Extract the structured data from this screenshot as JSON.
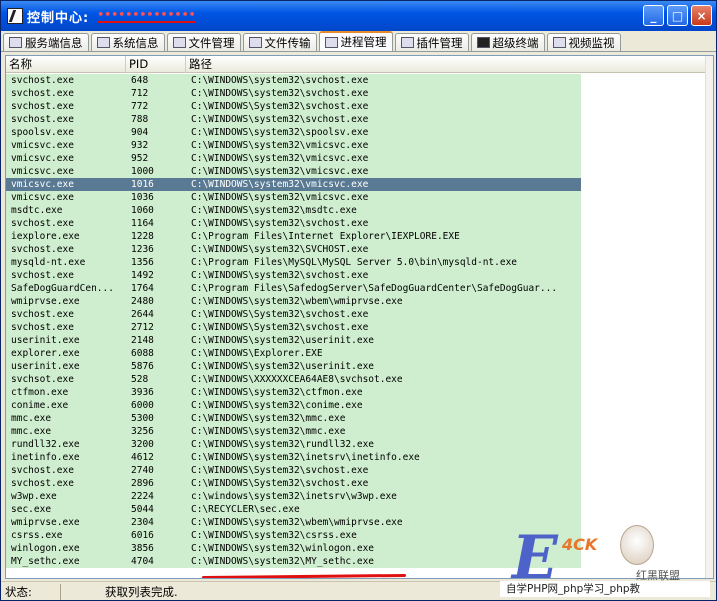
{
  "window": {
    "title": "控制中心:",
    "title_redacted": "••••••••••••••"
  },
  "titlebar_buttons": {
    "minimize": "_",
    "maximize": "□",
    "close": "×"
  },
  "tabs": [
    {
      "label": "服务端信息",
      "icon": "server-icon"
    },
    {
      "label": "系统信息",
      "icon": "system-icon"
    },
    {
      "label": "文件管理",
      "icon": "folder-icon"
    },
    {
      "label": "文件传输",
      "icon": "transfer-icon"
    },
    {
      "label": "进程管理",
      "icon": "process-icon",
      "active": true
    },
    {
      "label": "插件管理",
      "icon": "plugin-icon"
    },
    {
      "label": "超级终端",
      "icon": "terminal-icon"
    },
    {
      "label": "视频监视",
      "icon": "camera-icon"
    }
  ],
  "table": {
    "columns": [
      "名称",
      "PID",
      "路径"
    ],
    "rows": [
      [
        "svchost.exe",
        "648",
        "C:\\WINDOWS\\system32\\svchost.exe"
      ],
      [
        "svchost.exe",
        "712",
        "C:\\WINDOWS\\system32\\svchost.exe"
      ],
      [
        "svchost.exe",
        "772",
        "C:\\WINDOWS\\System32\\svchost.exe"
      ],
      [
        "svchost.exe",
        "788",
        "C:\\WINDOWS\\system32\\svchost.exe"
      ],
      [
        "spoolsv.exe",
        "904",
        "C:\\WINDOWS\\system32\\spoolsv.exe"
      ],
      [
        "vmicsvc.exe",
        "932",
        "C:\\WINDOWS\\system32\\vmicsvc.exe"
      ],
      [
        "vmicsvc.exe",
        "952",
        "C:\\WINDOWS\\system32\\vmicsvc.exe"
      ],
      [
        "vmicsvc.exe",
        "1000",
        "C:\\WINDOWS\\system32\\vmicsvc.exe"
      ],
      [
        "vmicsvc.exe",
        "1016",
        "C:\\WINDOWS\\system32\\vmicsvc.exe"
      ],
      [
        "vmicsvc.exe",
        "1036",
        "C:\\WINDOWS\\system32\\vmicsvc.exe"
      ],
      [
        "msdtc.exe",
        "1060",
        "C:\\WINDOWS\\system32\\msdtc.exe"
      ],
      [
        "svchost.exe",
        "1164",
        "C:\\WINDOWS\\system32\\svchost.exe"
      ],
      [
        "iexplore.exe",
        "1228",
        "C:\\Program Files\\Internet Explorer\\IEXPLORE.EXE"
      ],
      [
        "svchost.exe",
        "1236",
        "C:\\WINDOWS\\system32\\SVCHOST.exe"
      ],
      [
        "mysqld-nt.exe",
        "1356",
        "C:\\Program Files\\MySQL\\MySQL Server 5.0\\bin\\mysqld-nt.exe"
      ],
      [
        "svchost.exe",
        "1492",
        "C:\\WINDOWS\\system32\\svchost.exe"
      ],
      [
        "SafeDogGuardCen...",
        "1764",
        "C:\\Program Files\\SafedogServer\\SafeDogGuardCenter\\SafeDogGuar..."
      ],
      [
        "wmiprvse.exe",
        "2480",
        "C:\\WINDOWS\\system32\\wbem\\wmiprvse.exe"
      ],
      [
        "svchost.exe",
        "2644",
        "C:\\WINDOWS\\System32\\svchost.exe"
      ],
      [
        "svchost.exe",
        "2712",
        "C:\\WINDOWS\\System32\\svchost.exe"
      ],
      [
        "userinit.exe",
        "2148",
        "C:\\WINDOWS\\system32\\userinit.exe"
      ],
      [
        "explorer.exe",
        "6088",
        "C:\\WINDOWS\\Explorer.EXE"
      ],
      [
        "userinit.exe",
        "5876",
        "C:\\WINDOWS\\system32\\userinit.exe"
      ],
      [
        "svchsot.exe",
        "528",
        "C:\\WINDOWS\\XXXXXXCEA64AE8\\svchsot.exe"
      ],
      [
        "ctfmon.exe",
        "3936",
        "C:\\WINDOWS\\system32\\ctfmon.exe"
      ],
      [
        "conime.exe",
        "6000",
        "C:\\WINDOWS\\system32\\conime.exe"
      ],
      [
        "mmc.exe",
        "5300",
        "C:\\WINDOWS\\system32\\mmc.exe"
      ],
      [
        "mmc.exe",
        "3256",
        "C:\\WINDOWS\\system32\\mmc.exe"
      ],
      [
        "rundll32.exe",
        "3200",
        "C:\\WINDOWS\\system32\\rundll32.exe"
      ],
      [
        "inetinfo.exe",
        "4612",
        "C:\\WINDOWS\\system32\\inetsrv\\inetinfo.exe"
      ],
      [
        "svchost.exe",
        "2740",
        "C:\\WINDOWS\\System32\\svchost.exe"
      ],
      [
        "svchost.exe",
        "2896",
        "C:\\WINDOWS\\System32\\svchost.exe"
      ],
      [
        "w3wp.exe",
        "2224",
        "c:\\windows\\system32\\inetsrv\\w3wp.exe"
      ],
      [
        "sec.exe",
        "5044",
        "C:\\RECYCLER\\sec.exe"
      ],
      [
        "wmiprvse.exe",
        "2304",
        "C:\\WINDOWS\\system32\\wbem\\wmiprvse.exe"
      ],
      [
        "csrss.exe",
        "6016",
        "C:\\WINDOWS\\system32\\csrss.exe"
      ],
      [
        "winlogon.exe",
        "3856",
        "C:\\WINDOWS\\system32\\winlogon.exe"
      ],
      [
        "MY_sethc.exe",
        "4704",
        "C:\\WINDOWS\\system32\\MY_sethc.exe"
      ]
    ],
    "selected_index": 8
  },
  "status": {
    "label": "状态:",
    "value": "获取列表完成."
  },
  "watermark": {
    "brand": "4CK",
    "union": "红黑联盟",
    "site": "自学PHP网_php学习_php教"
  },
  "colors": {
    "row_bg": "#cfeecf",
    "selected_bg": "#5a7a94",
    "titlebar": "#0055e5",
    "highlight_underline": "#e01010"
  }
}
